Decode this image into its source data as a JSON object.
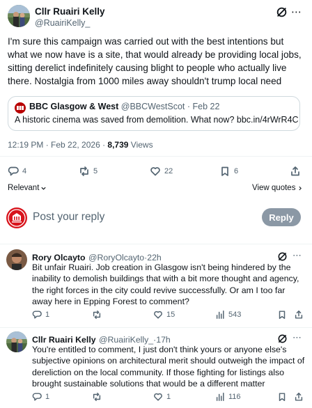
{
  "main_tweet": {
    "author_name": "Cllr Ruairi Kelly",
    "author_handle": "@RuairiKelly_",
    "text": "I'm sure this campaign was carried out with the best intentions but what we now have is a site, that would already be providing local jobs, sitting derelict indefinitely causing blight to people who actually live there. Nostalgia from 1000 miles away shouldn't trump local need",
    "quoted": {
      "author_name": "BBC Glasgow & West",
      "author_handle": "@BBCWestScot",
      "date": "Feb 22",
      "separator": "·",
      "text": "A historic cinema was saved from demolition. What now? bbc.in/4rWrR4C"
    },
    "timestamp": "12:19 PM · Feb 22, 2026 · ",
    "views_count": "8,739",
    "views_label": " Views",
    "stats": {
      "replies": "4",
      "reposts": "5",
      "likes": "22",
      "bookmarks": "6"
    },
    "relevant_label": "Relevant",
    "view_quotes_label": "View quotes"
  },
  "composer": {
    "placeholder": "Post your reply",
    "button_label": "Reply"
  },
  "replies": [
    {
      "author_name": "Rory Olcayto",
      "author_handle": "@RoryOlcayto",
      "time": "22h",
      "separator": "·",
      "text": "Bit unfair Ruairi. Job creation in Glasgow isn't being hindered by the inability to demolish buildings that with a bit more thought and agency, the right forces in the city could revive successfully. Or am I too far away here in Epping Forest to comment?",
      "stats": {
        "replies": "1",
        "reposts": "",
        "likes": "15",
        "views": "543"
      }
    },
    {
      "author_name": "Cllr Ruairi Kelly",
      "author_handle": "@RuairiKelly_",
      "time": "17h",
      "separator": "·",
      "text": "You're entitled to comment, I just don't think yours or anyone else's subjective opinions on architectural merit should outweigh the impact of dereliction on the local community. If those fighting for listings also brought sustainable solutions that would be a different matter",
      "stats": {
        "replies": "1",
        "reposts": "",
        "likes": "1",
        "views": "116"
      }
    }
  ],
  "colors": {
    "text": "#0f1419",
    "muted": "#536471",
    "divider": "#eff3f4",
    "reply_button": "#8b98a5",
    "bbc_red": "#b80000"
  }
}
